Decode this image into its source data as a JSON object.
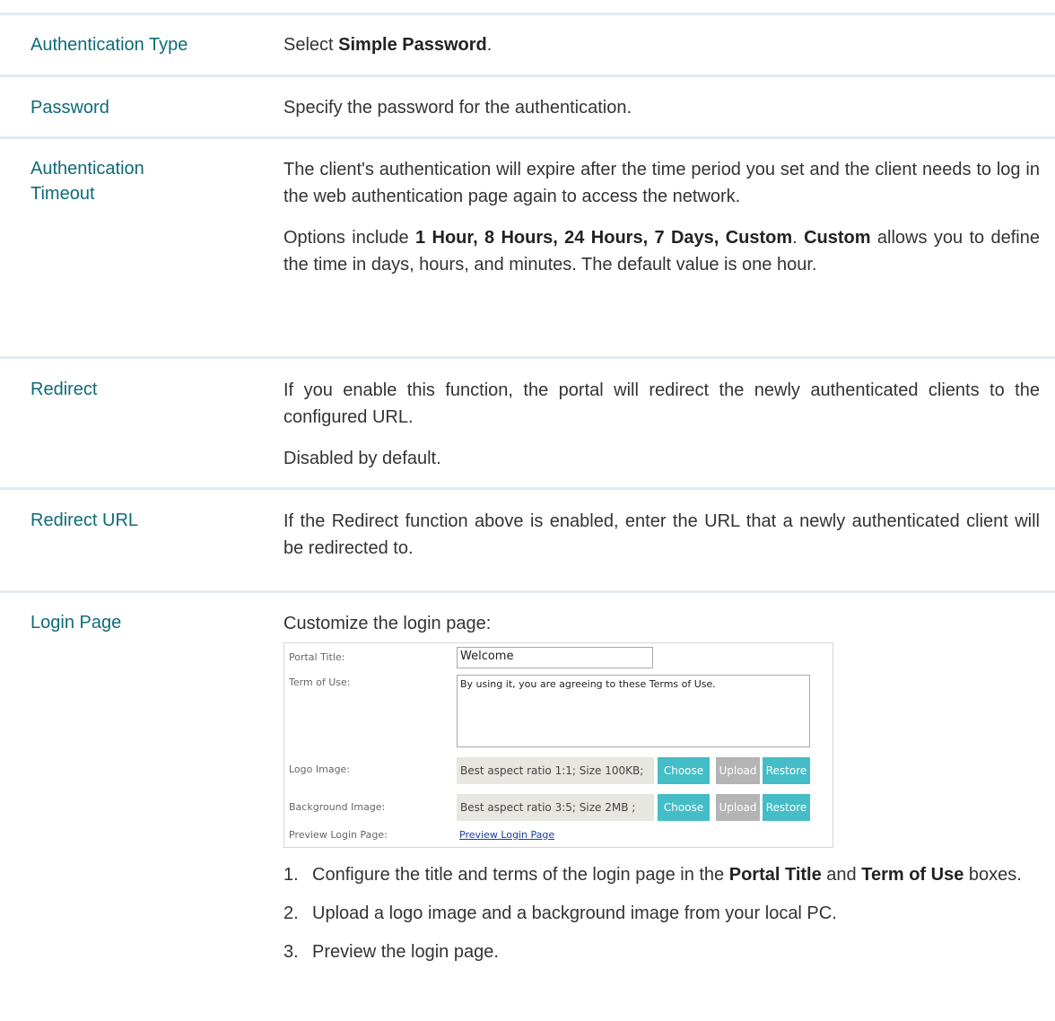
{
  "rows": [
    {
      "term": "Authentication Type",
      "desc": [
        "Select ",
        "Simple Password",
        "."
      ]
    },
    {
      "term": "Password",
      "desc": "Specify the password for the authentication."
    },
    {
      "term_line1": "Authentication",
      "term_line2": "Timeout",
      "p1": "The client's authentication will expire after the time period you set and the client needs to log in the web authentication page again to access the network.",
      "p2": [
        "Options include ",
        "1 Hour, 8 Hours, 24 Hours, 7 Days, Custom",
        ". ",
        "Custom",
        " allows you to define the time in days, hours, and minutes. The default value is one hour."
      ]
    },
    {
      "term": "Redirect",
      "p1": "If you enable this function, the portal will redirect the newly authenticated clients to the configured URL.",
      "p2": "Disabled by default."
    },
    {
      "term": "Redirect URL",
      "desc": "If the Redirect function above is enabled, enter the URL that a newly authenticated client will be redirected to."
    },
    {
      "term": "Login Page",
      "intro": "Customize the login page:"
    }
  ],
  "panel": {
    "portal_title_label": "Portal Title:",
    "portal_title_value": "Welcome",
    "term_of_use_label": "Term of Use:",
    "term_of_use_value": "By using it, you are agreeing to these Terms of Use.",
    "logo_label": "Logo Image:",
    "logo_hint": "Best aspect ratio 1:1; Size 100KB;",
    "background_label": "Background Image:",
    "background_hint": "Best aspect ratio 3:5; Size 2MB ;",
    "choose": "Choose",
    "upload": "Upload",
    "restore": "Restore",
    "preview_label": "Preview Login Page:",
    "preview_link": "Preview Login Page"
  },
  "steps": [
    {
      "num": "1.",
      "parts": [
        "Configure the title and terms of the login page in the ",
        "Portal Title",
        " and ",
        "Term of Use",
        " boxes."
      ]
    },
    {
      "num": "2.",
      "text": "Upload a logo image and a background image from your local PC."
    },
    {
      "num": "3.",
      "text": "Preview the login page."
    }
  ],
  "colors": {
    "term": "#0e6b78",
    "rule": "#e3ebf1",
    "button_teal": "#45bdc7",
    "button_gray": "#b4b4b4",
    "link": "#1a3aa8"
  }
}
